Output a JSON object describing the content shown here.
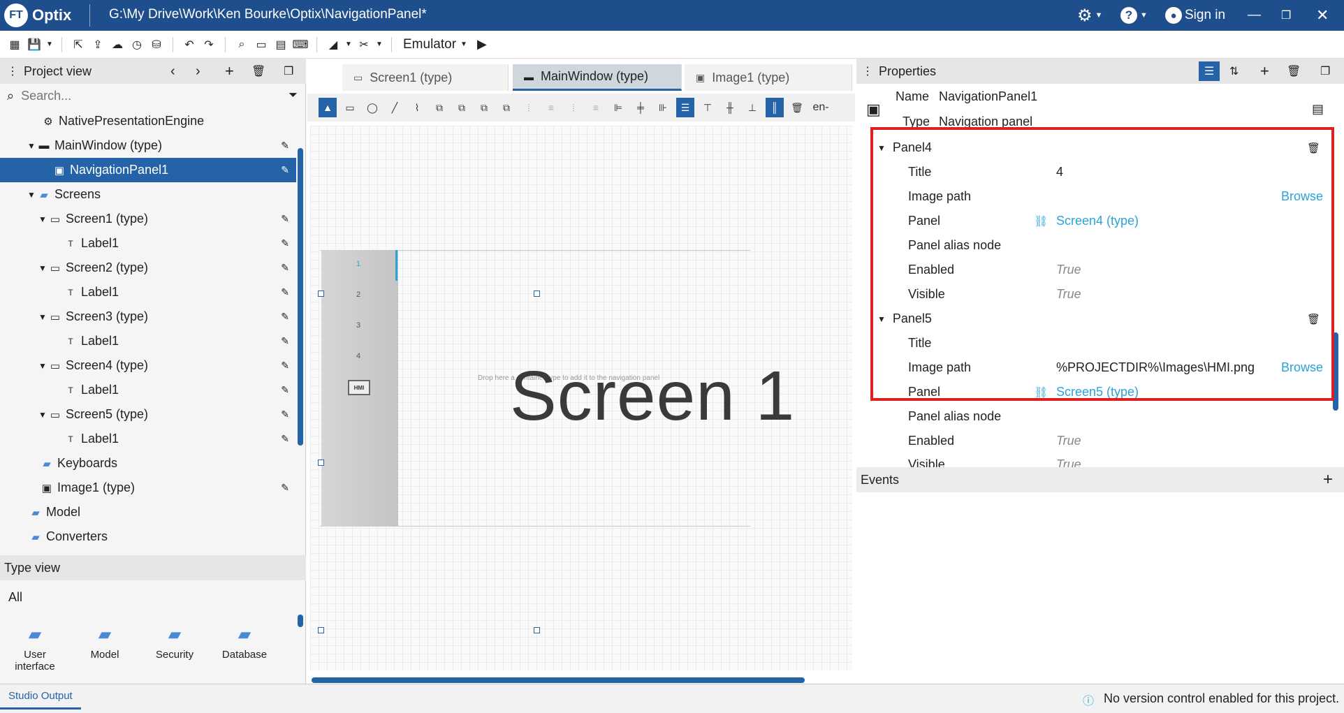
{
  "titlebar": {
    "logo_badge": "FT",
    "logo_text": "Optix",
    "path": "G:\\My Drive\\Work\\Ken Bourke\\Optix\\NavigationPanel*",
    "sign_in": "Sign in"
  },
  "toolbar": {
    "emulator_label": "Emulator"
  },
  "project_view": {
    "title": "Project view",
    "search_placeholder": "Search...",
    "items": [
      {
        "label": "NativePresentationEngine"
      },
      {
        "label": "MainWindow (type)"
      },
      {
        "label": "NavigationPanel1"
      },
      {
        "label": "Screens"
      },
      {
        "label": "Screen1 (type)"
      },
      {
        "label": "Label1"
      },
      {
        "label": "Screen2 (type)"
      },
      {
        "label": "Label1"
      },
      {
        "label": "Screen3 (type)"
      },
      {
        "label": "Label1"
      },
      {
        "label": "Screen4 (type)"
      },
      {
        "label": "Label1"
      },
      {
        "label": "Screen5 (type)"
      },
      {
        "label": "Label1"
      },
      {
        "label": "Keyboards"
      },
      {
        "label": "Image1 (type)"
      },
      {
        "label": "Model"
      },
      {
        "label": "Converters"
      }
    ]
  },
  "type_view": {
    "title": "Type view",
    "filter": "All",
    "items": [
      {
        "label": "User interface"
      },
      {
        "label": "Model"
      },
      {
        "label": "Security"
      },
      {
        "label": "Database"
      }
    ]
  },
  "editor": {
    "tabs": [
      {
        "label": "Screen1 (type)"
      },
      {
        "label": "MainWindow (type)"
      },
      {
        "label": "Image1 (type)"
      }
    ],
    "locale": "en-",
    "canvas_text": "Screen 1",
    "drop_hint": "Drop here a container type to add it to the navigation panel",
    "nav_items": [
      "1",
      "2",
      "3",
      "4"
    ],
    "nav_image_text": "HMI"
  },
  "properties": {
    "title": "Properties",
    "name_label": "Name",
    "name_value": "NavigationPanel1",
    "type_label": "Type",
    "type_value": "Navigation panel",
    "panels": [
      {
        "header": "Panel4",
        "title_label": "Title",
        "title_value": "4",
        "image_path_label": "Image path",
        "image_path_value": "",
        "browse": "Browse",
        "panel_label": "Panel",
        "panel_value": "Screen4 (type)",
        "alias_label": "Panel alias node",
        "enabled_label": "Enabled",
        "enabled_value": "True",
        "visible_label": "Visible",
        "visible_value": "True"
      },
      {
        "header": "Panel5",
        "title_label": "Title",
        "title_value": "",
        "image_path_label": "Image path",
        "image_path_value": "%PROJECTDIR%\\Images\\HMI.png",
        "browse": "Browse",
        "panel_label": "Panel",
        "panel_value": "Screen5 (type)",
        "alias_label": "Panel alias node",
        "enabled_label": "Enabled",
        "enabled_value": "True",
        "visible_label": "Visible",
        "visible_value": "True"
      }
    ],
    "highlight_color": "#e02020"
  },
  "events": {
    "title": "Events"
  },
  "status": {
    "output_tab": "Studio Output",
    "message": "No version control enabled for this project."
  }
}
